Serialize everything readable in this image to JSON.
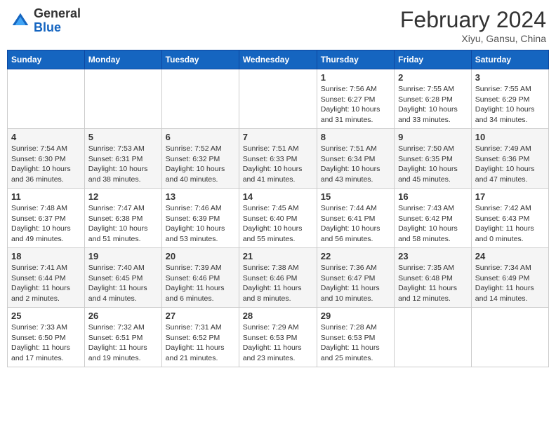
{
  "header": {
    "logo": {
      "general": "General",
      "blue": "Blue"
    },
    "title": "February 2024",
    "location": "Xiyu, Gansu, China"
  },
  "days_of_week": [
    "Sunday",
    "Monday",
    "Tuesday",
    "Wednesday",
    "Thursday",
    "Friday",
    "Saturday"
  ],
  "weeks": [
    [
      null,
      null,
      null,
      null,
      {
        "day": 1,
        "sunrise": "7:56 AM",
        "sunset": "6:27 PM",
        "daylight": "10 hours and 31 minutes."
      },
      {
        "day": 2,
        "sunrise": "7:55 AM",
        "sunset": "6:28 PM",
        "daylight": "10 hours and 33 minutes."
      },
      {
        "day": 3,
        "sunrise": "7:55 AM",
        "sunset": "6:29 PM",
        "daylight": "10 hours and 34 minutes."
      }
    ],
    [
      {
        "day": 4,
        "sunrise": "7:54 AM",
        "sunset": "6:30 PM",
        "daylight": "10 hours and 36 minutes."
      },
      {
        "day": 5,
        "sunrise": "7:53 AM",
        "sunset": "6:31 PM",
        "daylight": "10 hours and 38 minutes."
      },
      {
        "day": 6,
        "sunrise": "7:52 AM",
        "sunset": "6:32 PM",
        "daylight": "10 hours and 40 minutes."
      },
      {
        "day": 7,
        "sunrise": "7:51 AM",
        "sunset": "6:33 PM",
        "daylight": "10 hours and 41 minutes."
      },
      {
        "day": 8,
        "sunrise": "7:51 AM",
        "sunset": "6:34 PM",
        "daylight": "10 hours and 43 minutes."
      },
      {
        "day": 9,
        "sunrise": "7:50 AM",
        "sunset": "6:35 PM",
        "daylight": "10 hours and 45 minutes."
      },
      {
        "day": 10,
        "sunrise": "7:49 AM",
        "sunset": "6:36 PM",
        "daylight": "10 hours and 47 minutes."
      }
    ],
    [
      {
        "day": 11,
        "sunrise": "7:48 AM",
        "sunset": "6:37 PM",
        "daylight": "10 hours and 49 minutes."
      },
      {
        "day": 12,
        "sunrise": "7:47 AM",
        "sunset": "6:38 PM",
        "daylight": "10 hours and 51 minutes."
      },
      {
        "day": 13,
        "sunrise": "7:46 AM",
        "sunset": "6:39 PM",
        "daylight": "10 hours and 53 minutes."
      },
      {
        "day": 14,
        "sunrise": "7:45 AM",
        "sunset": "6:40 PM",
        "daylight": "10 hours and 55 minutes."
      },
      {
        "day": 15,
        "sunrise": "7:44 AM",
        "sunset": "6:41 PM",
        "daylight": "10 hours and 56 minutes."
      },
      {
        "day": 16,
        "sunrise": "7:43 AM",
        "sunset": "6:42 PM",
        "daylight": "10 hours and 58 minutes."
      },
      {
        "day": 17,
        "sunrise": "7:42 AM",
        "sunset": "6:43 PM",
        "daylight": "11 hours and 0 minutes."
      }
    ],
    [
      {
        "day": 18,
        "sunrise": "7:41 AM",
        "sunset": "6:44 PM",
        "daylight": "11 hours and 2 minutes."
      },
      {
        "day": 19,
        "sunrise": "7:40 AM",
        "sunset": "6:45 PM",
        "daylight": "11 hours and 4 minutes."
      },
      {
        "day": 20,
        "sunrise": "7:39 AM",
        "sunset": "6:46 PM",
        "daylight": "11 hours and 6 minutes."
      },
      {
        "day": 21,
        "sunrise": "7:38 AM",
        "sunset": "6:46 PM",
        "daylight": "11 hours and 8 minutes."
      },
      {
        "day": 22,
        "sunrise": "7:36 AM",
        "sunset": "6:47 PM",
        "daylight": "11 hours and 10 minutes."
      },
      {
        "day": 23,
        "sunrise": "7:35 AM",
        "sunset": "6:48 PM",
        "daylight": "11 hours and 12 minutes."
      },
      {
        "day": 24,
        "sunrise": "7:34 AM",
        "sunset": "6:49 PM",
        "daylight": "11 hours and 14 minutes."
      }
    ],
    [
      {
        "day": 25,
        "sunrise": "7:33 AM",
        "sunset": "6:50 PM",
        "daylight": "11 hours and 17 minutes."
      },
      {
        "day": 26,
        "sunrise": "7:32 AM",
        "sunset": "6:51 PM",
        "daylight": "11 hours and 19 minutes."
      },
      {
        "day": 27,
        "sunrise": "7:31 AM",
        "sunset": "6:52 PM",
        "daylight": "11 hours and 21 minutes."
      },
      {
        "day": 28,
        "sunrise": "7:29 AM",
        "sunset": "6:53 PM",
        "daylight": "11 hours and 23 minutes."
      },
      {
        "day": 29,
        "sunrise": "7:28 AM",
        "sunset": "6:53 PM",
        "daylight": "11 hours and 25 minutes."
      },
      null,
      null
    ]
  ]
}
